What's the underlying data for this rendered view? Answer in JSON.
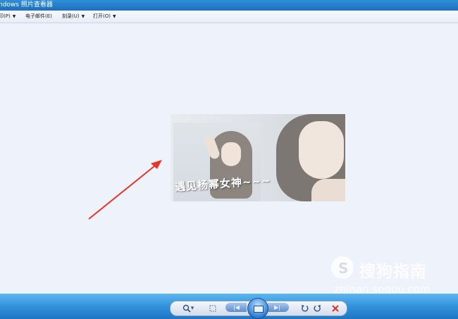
{
  "window": {
    "title": "ndows 照片查看器"
  },
  "menu": {
    "items": [
      {
        "label": "印(P)",
        "has_dropdown": true
      },
      {
        "label": "电子邮件(E)",
        "has_dropdown": false
      },
      {
        "label": "刻录(U)",
        "has_dropdown": true
      },
      {
        "label": "打开(O)",
        "has_dropdown": true
      }
    ]
  },
  "photo": {
    "caption": "遇见杨幂女神~~~"
  },
  "annotation": {
    "arrow_color": "#e8362c"
  },
  "watermark": {
    "brand": "搜狗指南",
    "url": "zhinan.sogou.com"
  },
  "controls": {
    "zoom_icon": "magnifier-icon",
    "zoom_caret": "▾",
    "fit_icon": "actual-size-icon",
    "prev_icon": "previous-icon",
    "slideshow_icon": "slideshow-icon",
    "next_icon": "next-icon",
    "rotate_ccw_icon": "rotate-counterclockwise-icon",
    "rotate_cw_icon": "rotate-clockwise-icon",
    "delete_icon": "delete-icon",
    "delete_color": "#d8322a"
  },
  "colors": {
    "titlebar": "#1d6fbf",
    "taskbar": "#2f8ed9",
    "viewer_bg": "#eef2fa"
  }
}
